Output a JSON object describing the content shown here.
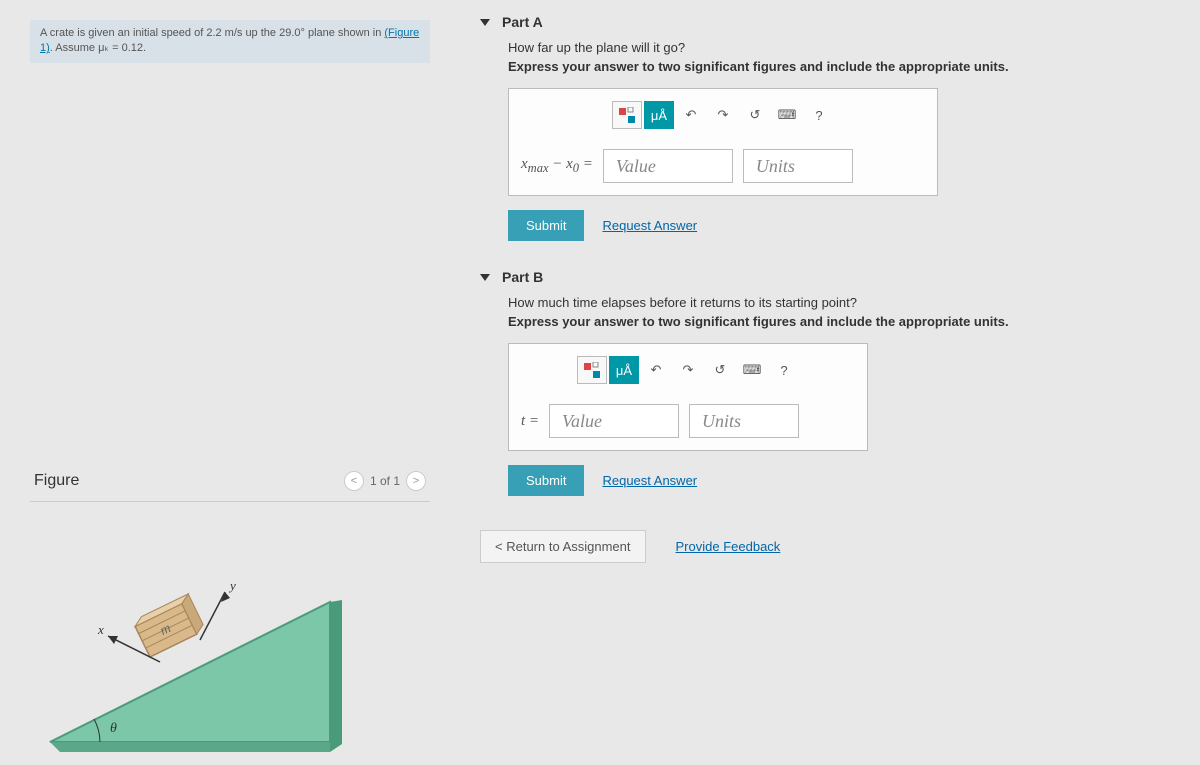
{
  "problem": {
    "text_before_link": "A crate is given an initial speed of 2.2 m/s up the 29.0° plane shown in ",
    "figure_link": "(Figure 1)",
    "text_after_link": ". Assume μₖ = 0.12."
  },
  "figure": {
    "title": "Figure",
    "nav_text": "1 of 1",
    "labels": {
      "x": "x",
      "y": "y",
      "mass": "m",
      "angle": "θ"
    }
  },
  "partA": {
    "title": "Part A",
    "prompt": "How far up the plane will it go?",
    "instruct": "Express your answer to two significant figures and include the appropriate units.",
    "lhs": "xₘₐₓ − x₀ =",
    "value_ph": "Value",
    "units_ph": "Units",
    "submit": "Submit",
    "request": "Request Answer",
    "tool_units": "μÅ",
    "tool_help": "?"
  },
  "partB": {
    "title": "Part B",
    "prompt": "How much time elapses before it returns to its starting point?",
    "instruct": "Express your answer to two significant figures and include the appropriate units.",
    "lhs": "t =",
    "value_ph": "Value",
    "units_ph": "Units",
    "submit": "Submit",
    "request": "Request Answer",
    "tool_units": "μÅ",
    "tool_help": "?"
  },
  "footer": {
    "return": "Return to Assignment",
    "feedback": "Provide Feedback"
  }
}
